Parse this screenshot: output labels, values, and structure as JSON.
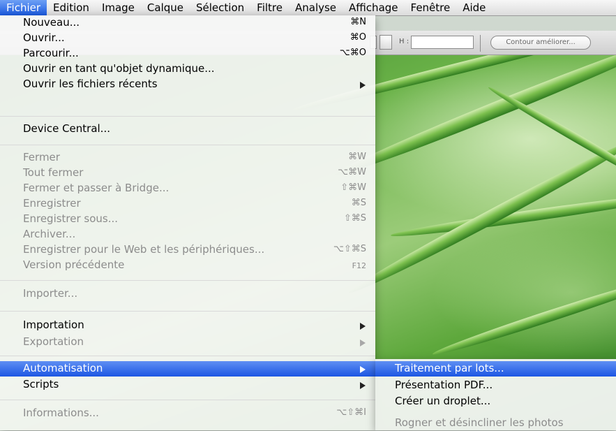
{
  "menubar": {
    "items": [
      "Fichier",
      "Edition",
      "Image",
      "Calque",
      "Sélection",
      "Filtre",
      "Analyse",
      "Affichage",
      "Fenêtre",
      "Aide"
    ],
    "active": "Fichier"
  },
  "toolbar": {
    "h_label": "H :",
    "refine_button": "Contour améliorer..."
  },
  "file_menu": {
    "items": [
      {
        "label": "Nouveau...",
        "shortcut": "⌘N",
        "enabled": true
      },
      {
        "label": "Ouvrir...",
        "shortcut": "⌘O",
        "enabled": true
      },
      {
        "label": "Parcourir...",
        "shortcut": "⌥⌘O",
        "enabled": true
      },
      {
        "label": "Ouvrir en tant qu'objet dynamique...",
        "shortcut": "",
        "enabled": true
      },
      {
        "label": "Ouvrir les fichiers récents",
        "shortcut": "",
        "enabled": true,
        "submenu": true
      },
      {
        "label": "Device Central...",
        "shortcut": "",
        "enabled": true
      },
      {
        "label": "Fermer",
        "shortcut": "⌘W",
        "enabled": false
      },
      {
        "label": "Tout fermer",
        "shortcut": "⌥⌘W",
        "enabled": false
      },
      {
        "label": "Fermer et passer à Bridge...",
        "shortcut": "⇧⌘W",
        "enabled": false
      },
      {
        "label": "Enregistrer",
        "shortcut": "⌘S",
        "enabled": false
      },
      {
        "label": "Enregistrer sous...",
        "shortcut": "⇧⌘S",
        "enabled": false
      },
      {
        "label": "Archiver...",
        "shortcut": "",
        "enabled": false
      },
      {
        "label": "Enregistrer pour le Web et les périphériques...",
        "shortcut": "⌥⇧⌘S",
        "enabled": false
      },
      {
        "label": "Version précédente",
        "shortcut": "F12",
        "enabled": false
      },
      {
        "label": "Importer...",
        "shortcut": "",
        "enabled": false
      },
      {
        "label": "Importation",
        "shortcut": "",
        "enabled": true,
        "submenu": true
      },
      {
        "label": "Exportation",
        "shortcut": "",
        "enabled": false,
        "submenu": true
      },
      {
        "label": "Automatisation",
        "shortcut": "",
        "enabled": true,
        "submenu": true,
        "selected": true
      },
      {
        "label": "Scripts",
        "shortcut": "",
        "enabled": true,
        "submenu": true
      },
      {
        "label": "Informations...",
        "shortcut": "⌥⇧⌘I",
        "enabled": false
      }
    ]
  },
  "automation_submenu": {
    "items": [
      {
        "label": "Traitement par lots...",
        "selected": true
      },
      {
        "label": "Présentation PDF..."
      },
      {
        "label": "Créer un droplet..."
      },
      {
        "label": "Rogner et désincliner les photos",
        "enabled": false
      }
    ]
  },
  "colors": {
    "selection": "#1c56e3",
    "disabled_text": "#8c8c8c"
  }
}
